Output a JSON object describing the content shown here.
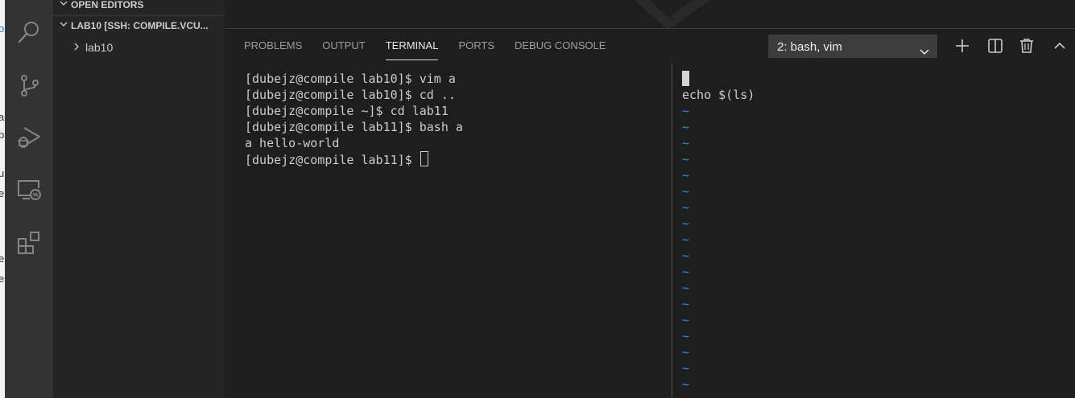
{
  "background_window": {
    "fragments": [
      "o",
      "a",
      "b",
      "u",
      "e",
      "e",
      "e"
    ]
  },
  "activity_bar": {
    "icons": [
      "search-icon",
      "source-control-icon",
      "run-debug-icon",
      "remote-explorer-icon",
      "extensions-icon"
    ]
  },
  "sidebar": {
    "open_editors_label": "OPEN EDITORS",
    "workspace_label": "LAB10 [SSH: COMPILE.VCU...",
    "items": [
      {
        "label": "lab10"
      }
    ]
  },
  "panel": {
    "tabs": [
      {
        "label": "PROBLEMS",
        "active": false
      },
      {
        "label": "OUTPUT",
        "active": false
      },
      {
        "label": "TERMINAL",
        "active": true
      },
      {
        "label": "PORTS",
        "active": false
      },
      {
        "label": "DEBUG CONSOLE",
        "active": false
      }
    ],
    "terminal_select": "2: bash, vim",
    "actions": [
      "new-terminal-icon",
      "split-terminal-icon",
      "kill-terminal-icon",
      "maximize-panel-icon"
    ]
  },
  "terminal_left": {
    "lines": [
      "[dubejz@compile lab10]$ vim a",
      "[dubejz@compile lab10]$ cd ..",
      "[dubejz@compile ~]$ cd lab11",
      "[dubejz@compile lab11]$ bash a",
      "a hello-world",
      "[dubejz@compile lab11]$ "
    ]
  },
  "terminal_right": {
    "content_line": "echo $(ls)",
    "tilde": "~",
    "tilde_count": 18
  },
  "colors": {
    "activity_bar": "#333333",
    "sidebar": "#252526",
    "editor": "#1e1e1e",
    "tilde": "#3b8eea"
  }
}
